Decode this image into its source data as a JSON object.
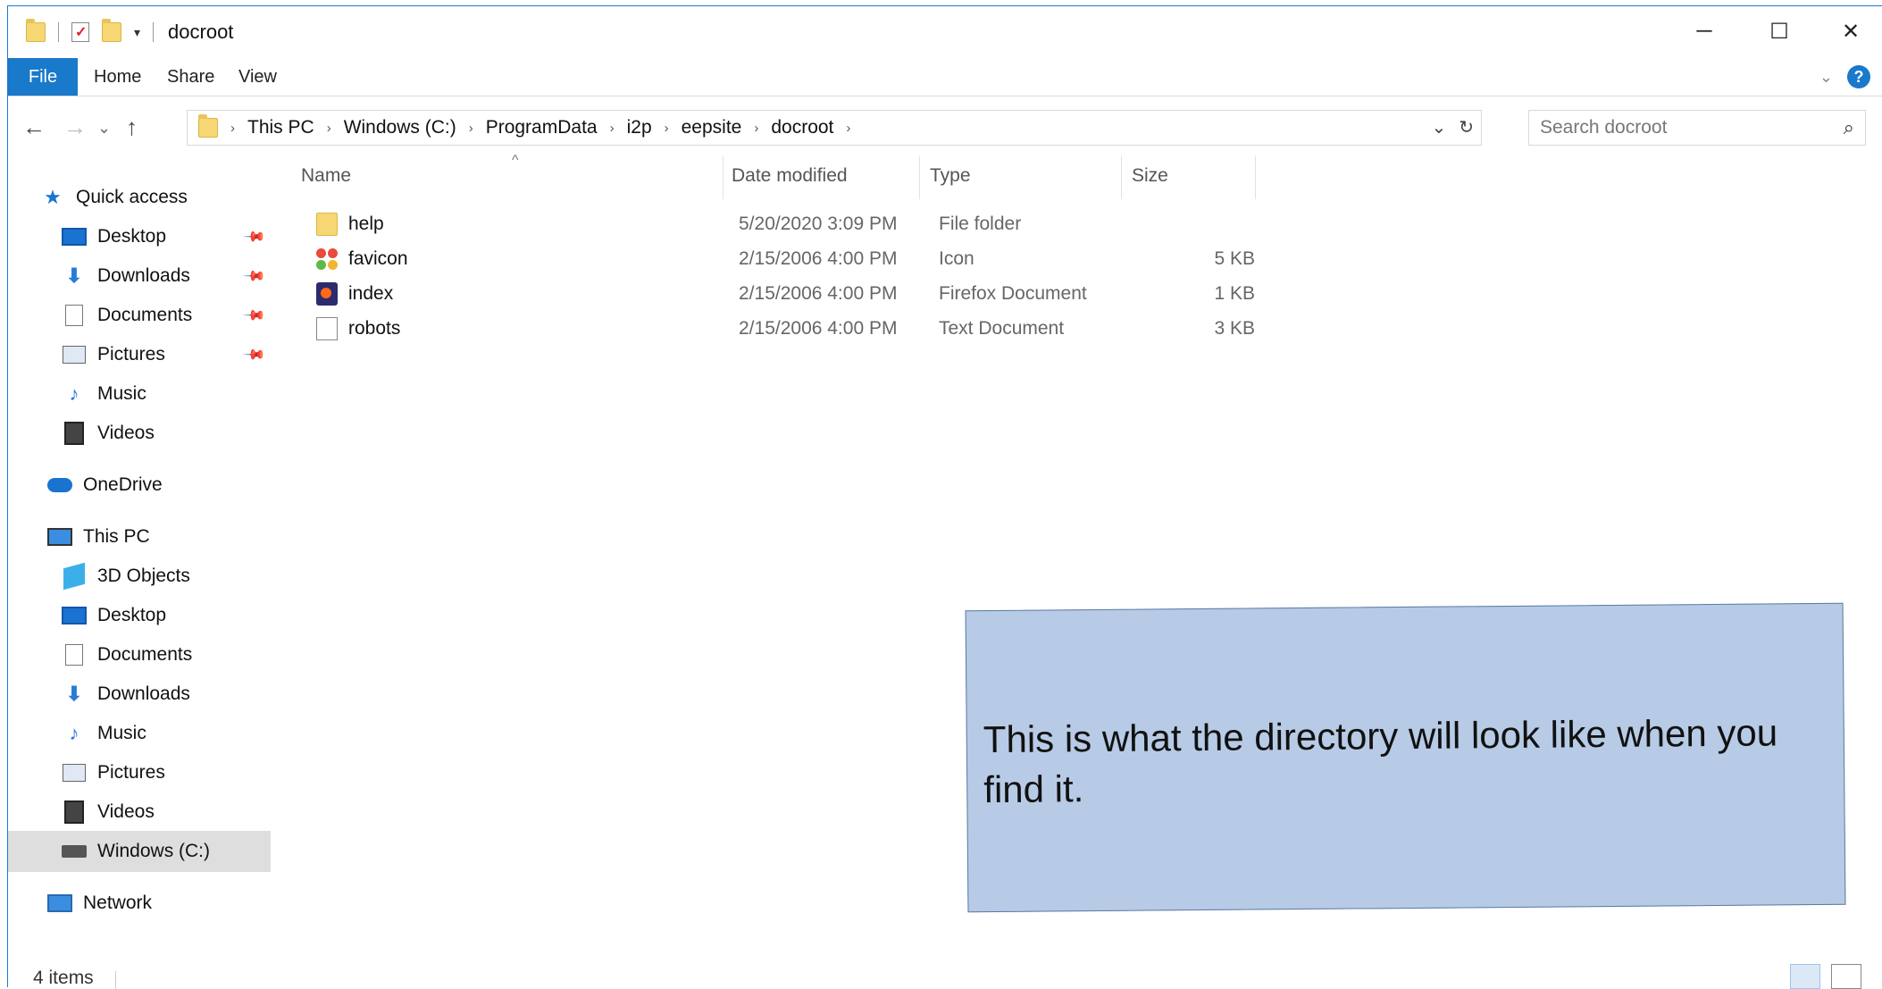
{
  "window": {
    "title": "docroot",
    "controls": {
      "minimize": "─",
      "maximize": "☐",
      "close": "✕"
    },
    "qat_dropdown": "▾"
  },
  "ribbon": {
    "tabs": [
      "File",
      "Home",
      "Share",
      "View"
    ],
    "expand_icon": "⌄",
    "help_icon": "?"
  },
  "nav": {
    "back": "←",
    "forward": "→",
    "recent": "⌄",
    "up": "↑",
    "breadcrumb": [
      "This PC",
      "Windows (C:)",
      "ProgramData",
      "i2p",
      "eepsite",
      "docroot"
    ],
    "crumb_sep": "›",
    "address_dropdown": "⌄",
    "refresh": "↻",
    "search_placeholder": "Search docroot",
    "search_icon": "⌕"
  },
  "sidebar": {
    "quick_access": "Quick access",
    "quick_items": [
      {
        "label": "Desktop",
        "pinned": true
      },
      {
        "label": "Downloads",
        "pinned": true
      },
      {
        "label": "Documents",
        "pinned": true
      },
      {
        "label": "Pictures",
        "pinned": true
      },
      {
        "label": "Music",
        "pinned": false
      },
      {
        "label": "Videos",
        "pinned": false
      }
    ],
    "onedrive": "OneDrive",
    "this_pc": "This PC",
    "pc_items": [
      "3D Objects",
      "Desktop",
      "Documents",
      "Downloads",
      "Music",
      "Pictures",
      "Videos",
      "Windows (C:)"
    ],
    "network": "Network",
    "selected": "Windows (C:)"
  },
  "file_list": {
    "columns": [
      "Name",
      "Date modified",
      "Type",
      "Size"
    ],
    "sort_indicator": "^",
    "rows": [
      {
        "name": "help",
        "date": "5/20/2020 3:09 PM",
        "type": "File folder",
        "size": "",
        "icon": "folder-icon"
      },
      {
        "name": "favicon",
        "date": "2/15/2006 4:00 PM",
        "type": "Icon",
        "size": "5 KB",
        "icon": "favicon-icon"
      },
      {
        "name": "index",
        "date": "2/15/2006 4:00 PM",
        "type": "Firefox Document",
        "size": "1 KB",
        "icon": "firefox-document-icon"
      },
      {
        "name": "robots",
        "date": "2/15/2006 4:00 PM",
        "type": "Text Document",
        "size": "3 KB",
        "icon": "text-document-icon"
      }
    ]
  },
  "status": {
    "item_count": "4 items"
  },
  "callout": {
    "text": "This is what the directory will look like when you find it."
  },
  "colors": {
    "accent": "#1979ca",
    "callout_bg": "#b7cbe6",
    "selected_bg": "#dedede"
  }
}
